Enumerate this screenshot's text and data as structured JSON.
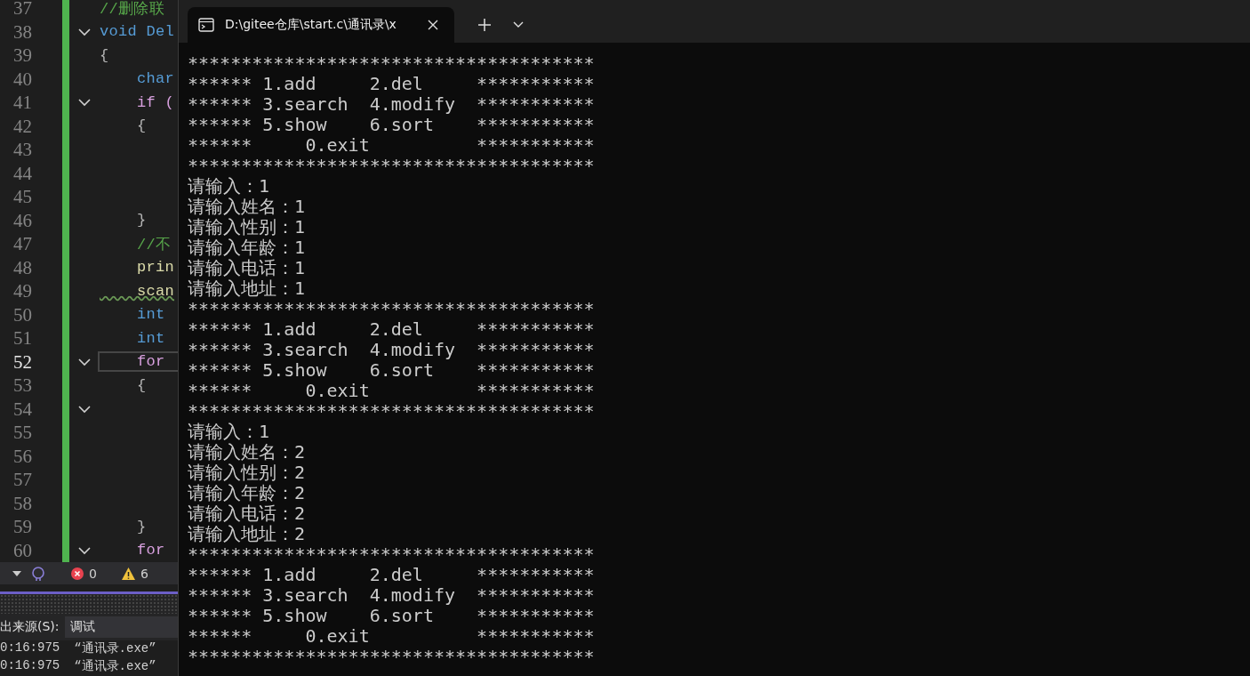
{
  "editor": {
    "lines": [
      {
        "number": "37",
        "code": "//删除联",
        "kind": "comment",
        "fold": false,
        "current": false
      },
      {
        "number": "38",
        "code": "void Del",
        "kind": "decl",
        "fold": true,
        "current": false
      },
      {
        "number": "39",
        "code": "{",
        "kind": "plain",
        "fold": false,
        "current": false
      },
      {
        "number": "40",
        "code": "    char",
        "kind": "type",
        "fold": false,
        "current": false
      },
      {
        "number": "41",
        "code": "    if (",
        "kind": "control",
        "fold": true,
        "current": false
      },
      {
        "number": "42",
        "code": "    {",
        "kind": "plain",
        "fold": false,
        "current": false
      },
      {
        "number": "43",
        "fold": false,
        "current": false
      },
      {
        "number": "44",
        "fold": false,
        "current": false
      },
      {
        "number": "45",
        "fold": false,
        "current": false
      },
      {
        "number": "46",
        "code": "    }",
        "kind": "plain",
        "fold": false,
        "current": false
      },
      {
        "number": "47",
        "code": "    //不",
        "kind": "comment",
        "fold": false,
        "current": false
      },
      {
        "number": "48",
        "code": "    prin",
        "kind": "func",
        "fold": false,
        "current": false
      },
      {
        "number": "49",
        "code": "    scan",
        "kind": "warn",
        "fold": false,
        "current": false
      },
      {
        "number": "50",
        "code": "    int",
        "kind": "type",
        "fold": false,
        "current": false
      },
      {
        "number": "51",
        "code": "    int",
        "kind": "type",
        "fold": false,
        "current": false
      },
      {
        "number": "52",
        "code": "    for",
        "kind": "control",
        "fold": true,
        "current": true
      },
      {
        "number": "53",
        "code": "    {",
        "kind": "plain",
        "fold": false,
        "current": false
      },
      {
        "number": "54",
        "fold": true,
        "current": false
      },
      {
        "number": "55",
        "fold": false,
        "current": false
      },
      {
        "number": "56",
        "fold": false,
        "current": false
      },
      {
        "number": "57",
        "fold": false,
        "current": false
      },
      {
        "number": "58",
        "fold": false,
        "current": false
      },
      {
        "number": "59",
        "code": "    }",
        "kind": "plain",
        "fold": false,
        "current": false
      },
      {
        "number": "60",
        "code": "    for",
        "kind": "control",
        "fold": true,
        "current": false
      }
    ]
  },
  "status_bar": {
    "errors": "0",
    "warnings": "6"
  },
  "output": {
    "source_label": "出来源(S):",
    "source_value": "调试",
    "log": [
      {
        "time": "0:16:975",
        "message": "“通讯录.exe”"
      },
      {
        "time": "0:16:975",
        "message": "“通讯录.exe”"
      }
    ]
  },
  "terminal": {
    "tab_title": "D:\\gitee仓库\\start.c\\通讯录\\x",
    "lines": [
      "**************************************",
      "****** 1.add     2.del     ***********",
      "****** 3.search  4.modify  ***********",
      "****** 5.show    6.sort    ***********",
      "******     0.exit          ***********",
      "**************************************",
      "请输入：1",
      "请输入姓名：1",
      "请输入性别：1",
      "请输入年龄：1",
      "请输入电话：1",
      "请输入地址：1",
      "**************************************",
      "****** 1.add     2.del     ***********",
      "****** 3.search  4.modify  ***********",
      "****** 5.show    6.sort    ***********",
      "******     0.exit          ***********",
      "**************************************",
      "请输入：1",
      "请输入姓名：2",
      "请输入性别：2",
      "请输入年龄：2",
      "请输入电话：2",
      "请输入地址：2",
      "**************************************",
      "****** 1.add     2.del     ***********",
      "****** 3.search  4.modify  ***********",
      "****** 5.show    6.sort    ***********",
      "******     0.exit          ***********",
      "**************************************"
    ]
  }
}
